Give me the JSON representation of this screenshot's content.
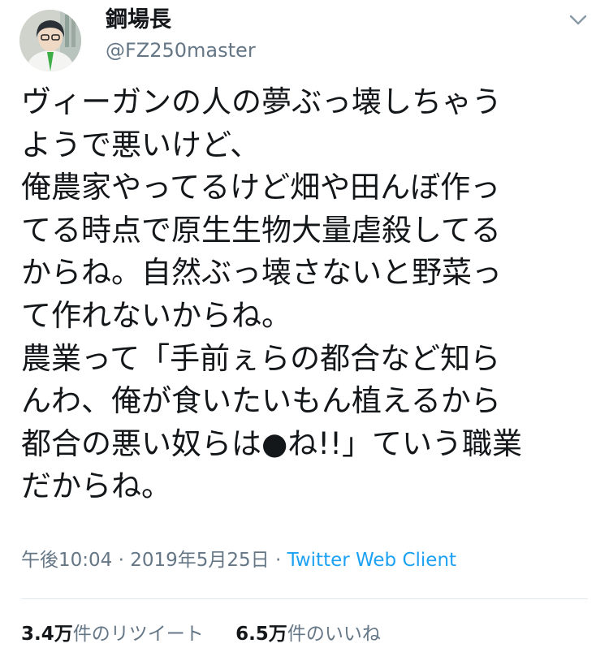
{
  "user": {
    "display_name": "鋼場長",
    "handle": "@FZ250master"
  },
  "tweet": {
    "lines": [
      "ヴィーガンの人の夢ぶっ壊しちゃう",
      "ようで悪いけど、",
      "俺農家やってるけど畑や田んぼ作っ",
      "てる時点で原生生物大量虐殺してる",
      "からね。自然ぶっ壊さないと野菜っ",
      "て作れないからね。",
      "農業って「手前ぇらの都合など知ら",
      "んわ、俺が食いたいもん植えるから",
      "都合の悪い奴らは●ね!!」ていう職業",
      "だからね。"
    ],
    "time": "午後10:04",
    "date": "2019年5月25日",
    "separator": "·",
    "client": "Twitter Web Client"
  },
  "stats": {
    "retweets_count": "3.4万",
    "retweets_label": "件のリツイート",
    "likes_count": "6.5万",
    "likes_label": "件のいいね"
  },
  "colors": {
    "text": "#14171a",
    "secondary": "#657786",
    "link": "#1da1f2",
    "divider": "#e1e8ed"
  },
  "icons": {
    "menu": "chevron-down-icon"
  }
}
